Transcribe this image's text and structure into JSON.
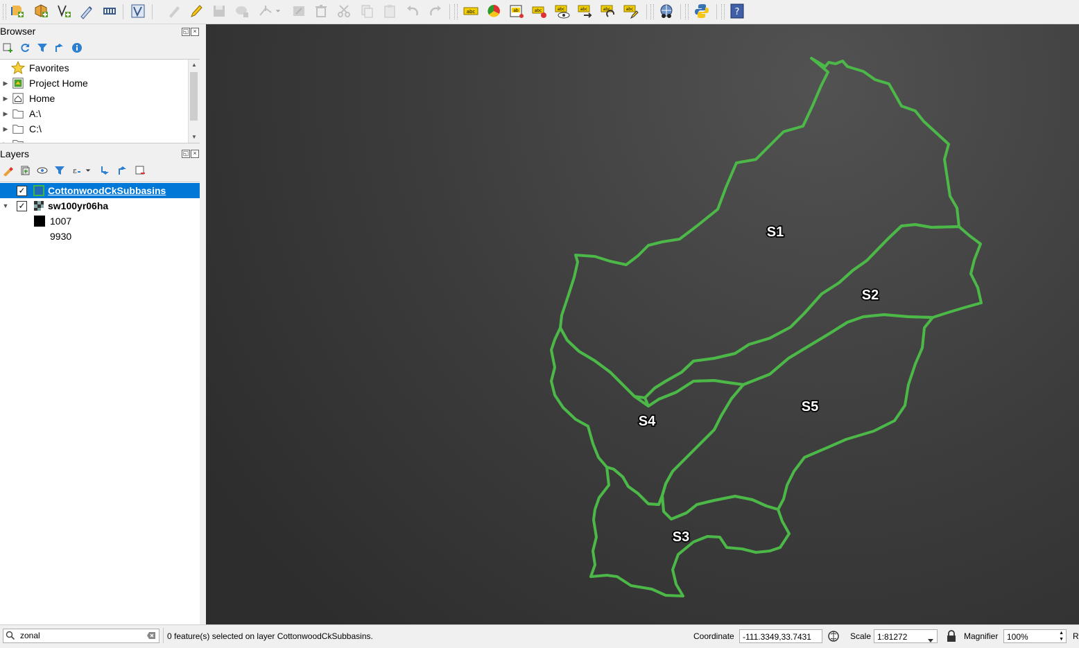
{
  "toolbar": {
    "icons": [
      "open-data-source-manager-icon",
      "new-geopackage-layer-icon",
      "new-shapefile-layer-icon",
      "new-temporary-scratch-layer-icon",
      "new-virtual-layer-icon",
      "digitize-icon",
      "current-edits-icon",
      "toggle-editing-icon",
      "save-layer-edits-icon",
      "add-feature-icon",
      "vertex-tool-icon",
      "modify-attributes-icon",
      "delete-selected-icon",
      "cut-features-icon",
      "copy-features-icon",
      "paste-features-icon",
      "undo-icon",
      "redo-icon",
      "label-toolbar-icon",
      "layer-diagram-icon",
      "highlight-pinned-labels-icon",
      "pin-labels-icon",
      "show-hide-labels-icon",
      "move-label-icon",
      "rotate-label-icon",
      "change-label-properties-icon",
      "plugin-icon",
      "python-console-icon",
      "help-icon"
    ]
  },
  "browser": {
    "title": "Browser",
    "items": [
      {
        "label": "Favorites",
        "icon": "star-icon",
        "expandable": false
      },
      {
        "label": "Project Home",
        "icon": "project-home-icon",
        "expandable": true
      },
      {
        "label": "Home",
        "icon": "home-icon",
        "expandable": true
      },
      {
        "label": "A:\\",
        "icon": "folder-icon",
        "expandable": true
      },
      {
        "label": "C:\\",
        "icon": "folder-icon",
        "expandable": true
      }
    ]
  },
  "layers": {
    "title": "Layers",
    "items": [
      {
        "label": "CottonwoodCkSubbasins",
        "checked": true,
        "selected": true
      },
      {
        "label": "sw100yr06ha",
        "checked": true,
        "selected": false
      },
      {
        "label": "1007",
        "legend": "black"
      },
      {
        "label": "9930",
        "legend": "white"
      }
    ]
  },
  "map": {
    "labels": [
      "S1",
      "S2",
      "S3",
      "S4",
      "S5"
    ],
    "outline_color": "#4cb848"
  },
  "status": {
    "search_value": "zonal",
    "message": "0 feature(s) selected on layer CottonwoodCkSubbasins.",
    "coordinate_label": "Coordinate",
    "coordinate_value": "-111.3349,33.7431",
    "scale_label": "Scale",
    "scale_value": "1:81272",
    "magnifier_label": "Magnifier",
    "magnifier_value": "100%",
    "rotation_label": "R"
  }
}
